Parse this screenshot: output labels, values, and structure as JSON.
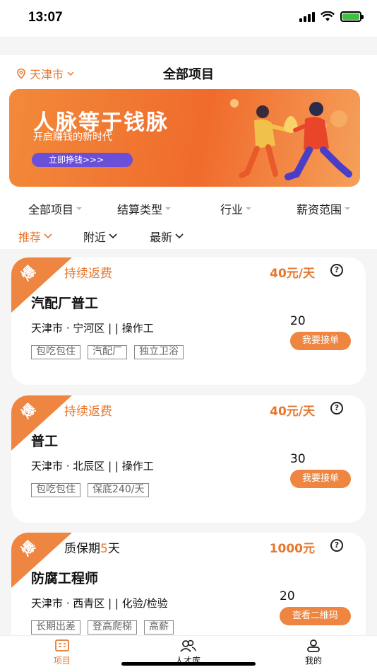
{
  "status_bar": {
    "time": "13:07"
  },
  "header": {
    "location": "天津市",
    "title": "全部项目"
  },
  "banner": {
    "title": "人脉等于钱脉",
    "subtitle": "开启赚钱的新时代",
    "button_label": "立即挣钱>>>"
  },
  "filters": [
    "全部项目",
    "结算类型",
    "行业",
    "薪资范围"
  ],
  "sort_options": [
    {
      "label": "推荐",
      "active": true
    },
    {
      "label": "附近",
      "active": false
    },
    {
      "label": "最新",
      "active": false
    }
  ],
  "jobs": [
    {
      "corner": "爆",
      "tag": "持续返费",
      "price": "40元/天",
      "title": "汽配厂普工",
      "location": "天津市 · 宁河区 | | 操作工",
      "count": "20",
      "button": "我要接单",
      "badges": [
        "包吃包住",
        "汽配厂",
        "独立卫浴"
      ]
    },
    {
      "corner": "爆",
      "tag": "持续返费",
      "price": "40元/天",
      "title": "普工",
      "location": "天津市 · 北辰区 | | 操作工",
      "count": "30",
      "button": "我要接单",
      "badges": [
        "包吃包住",
        "保底240/天"
      ]
    },
    {
      "corner": "爆",
      "tag_prefix": "质保期",
      "tag_num": "5",
      "tag_suffix": "天",
      "price": "1000元",
      "title": "防腐工程师",
      "location": "天津市 · 西青区 | | 化验/检验",
      "count": "20",
      "button": "查看二维码",
      "badges": [
        "长期出差",
        "登高爬梯",
        "高薪"
      ]
    }
  ],
  "tabbar": {
    "items": [
      {
        "label": "项目",
        "icon": "project-icon",
        "active": true
      },
      {
        "label": "人才库",
        "icon": "people-icon",
        "active": false
      },
      {
        "label": "我的",
        "icon": "person-icon",
        "active": false
      }
    ]
  },
  "colors": {
    "accent": "#e8772e",
    "banner_button": "#6a4fd8"
  }
}
